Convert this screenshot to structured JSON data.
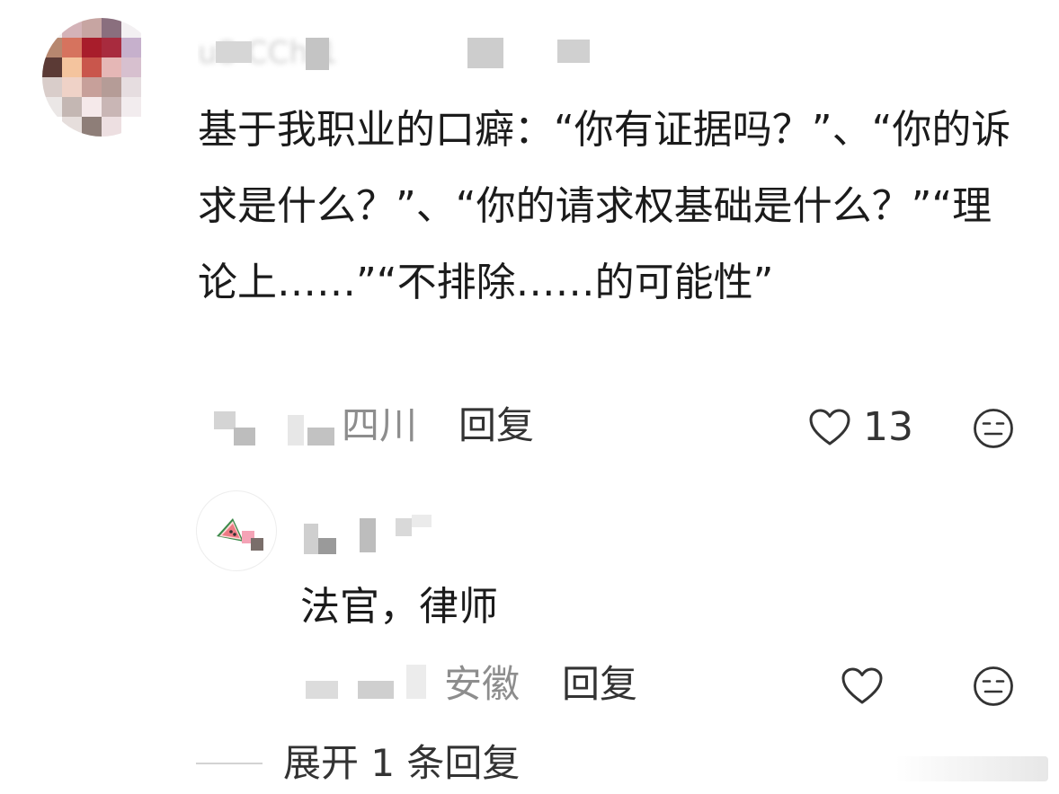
{
  "comment": {
    "username": "u8 CCh 1",
    "text": "基于我职业的口癖：“你有证据吗？”、“你的诉求是什么？”、“你的请求权基础是什么？”“理论上……”“不排除……的可能性”",
    "location": "四川",
    "reply_label": "回复",
    "like_count": "13"
  },
  "reply": {
    "text": "法官，律师",
    "location": "安徽",
    "reply_label": "回复"
  },
  "expand_label": "展开 1 条回复",
  "icons": {
    "like": "heart-outline-icon",
    "emoji": "neutral-face-icon"
  },
  "colors": {
    "text_primary": "#1b1b1b",
    "text_secondary": "#8d8d8d",
    "action_text": "#333333",
    "divider": "#d3d3d3"
  }
}
